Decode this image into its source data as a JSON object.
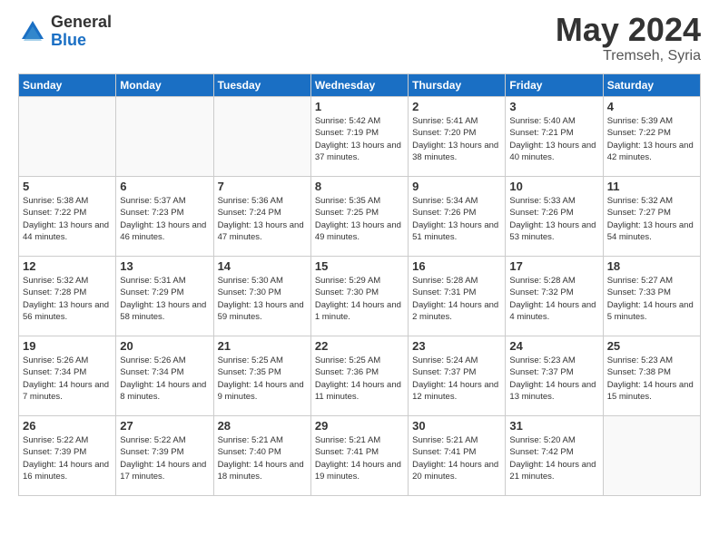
{
  "app": {
    "logo_general": "General",
    "logo_blue": "Blue",
    "month": "May 2024",
    "location": "Tremseh, Syria"
  },
  "calendar": {
    "headers": [
      "Sunday",
      "Monday",
      "Tuesday",
      "Wednesday",
      "Thursday",
      "Friday",
      "Saturday"
    ],
    "weeks": [
      [
        {
          "day": "",
          "info": ""
        },
        {
          "day": "",
          "info": ""
        },
        {
          "day": "",
          "info": ""
        },
        {
          "day": "1",
          "info": "Sunrise: 5:42 AM\nSunset: 7:19 PM\nDaylight: 13 hours\nand 37 minutes."
        },
        {
          "day": "2",
          "info": "Sunrise: 5:41 AM\nSunset: 7:20 PM\nDaylight: 13 hours\nand 38 minutes."
        },
        {
          "day": "3",
          "info": "Sunrise: 5:40 AM\nSunset: 7:21 PM\nDaylight: 13 hours\nand 40 minutes."
        },
        {
          "day": "4",
          "info": "Sunrise: 5:39 AM\nSunset: 7:22 PM\nDaylight: 13 hours\nand 42 minutes."
        }
      ],
      [
        {
          "day": "5",
          "info": "Sunrise: 5:38 AM\nSunset: 7:22 PM\nDaylight: 13 hours\nand 44 minutes."
        },
        {
          "day": "6",
          "info": "Sunrise: 5:37 AM\nSunset: 7:23 PM\nDaylight: 13 hours\nand 46 minutes."
        },
        {
          "day": "7",
          "info": "Sunrise: 5:36 AM\nSunset: 7:24 PM\nDaylight: 13 hours\nand 47 minutes."
        },
        {
          "day": "8",
          "info": "Sunrise: 5:35 AM\nSunset: 7:25 PM\nDaylight: 13 hours\nand 49 minutes."
        },
        {
          "day": "9",
          "info": "Sunrise: 5:34 AM\nSunset: 7:26 PM\nDaylight: 13 hours\nand 51 minutes."
        },
        {
          "day": "10",
          "info": "Sunrise: 5:33 AM\nSunset: 7:26 PM\nDaylight: 13 hours\nand 53 minutes."
        },
        {
          "day": "11",
          "info": "Sunrise: 5:32 AM\nSunset: 7:27 PM\nDaylight: 13 hours\nand 54 minutes."
        }
      ],
      [
        {
          "day": "12",
          "info": "Sunrise: 5:32 AM\nSunset: 7:28 PM\nDaylight: 13 hours\nand 56 minutes."
        },
        {
          "day": "13",
          "info": "Sunrise: 5:31 AM\nSunset: 7:29 PM\nDaylight: 13 hours\nand 58 minutes."
        },
        {
          "day": "14",
          "info": "Sunrise: 5:30 AM\nSunset: 7:30 PM\nDaylight: 13 hours\nand 59 minutes."
        },
        {
          "day": "15",
          "info": "Sunrise: 5:29 AM\nSunset: 7:30 PM\nDaylight: 14 hours\nand 1 minute."
        },
        {
          "day": "16",
          "info": "Sunrise: 5:28 AM\nSunset: 7:31 PM\nDaylight: 14 hours\nand 2 minutes."
        },
        {
          "day": "17",
          "info": "Sunrise: 5:28 AM\nSunset: 7:32 PM\nDaylight: 14 hours\nand 4 minutes."
        },
        {
          "day": "18",
          "info": "Sunrise: 5:27 AM\nSunset: 7:33 PM\nDaylight: 14 hours\nand 5 minutes."
        }
      ],
      [
        {
          "day": "19",
          "info": "Sunrise: 5:26 AM\nSunset: 7:34 PM\nDaylight: 14 hours\nand 7 minutes."
        },
        {
          "day": "20",
          "info": "Sunrise: 5:26 AM\nSunset: 7:34 PM\nDaylight: 14 hours\nand 8 minutes."
        },
        {
          "day": "21",
          "info": "Sunrise: 5:25 AM\nSunset: 7:35 PM\nDaylight: 14 hours\nand 9 minutes."
        },
        {
          "day": "22",
          "info": "Sunrise: 5:25 AM\nSunset: 7:36 PM\nDaylight: 14 hours\nand 11 minutes."
        },
        {
          "day": "23",
          "info": "Sunrise: 5:24 AM\nSunset: 7:37 PM\nDaylight: 14 hours\nand 12 minutes."
        },
        {
          "day": "24",
          "info": "Sunrise: 5:23 AM\nSunset: 7:37 PM\nDaylight: 14 hours\nand 13 minutes."
        },
        {
          "day": "25",
          "info": "Sunrise: 5:23 AM\nSunset: 7:38 PM\nDaylight: 14 hours\nand 15 minutes."
        }
      ],
      [
        {
          "day": "26",
          "info": "Sunrise: 5:22 AM\nSunset: 7:39 PM\nDaylight: 14 hours\nand 16 minutes."
        },
        {
          "day": "27",
          "info": "Sunrise: 5:22 AM\nSunset: 7:39 PM\nDaylight: 14 hours\nand 17 minutes."
        },
        {
          "day": "28",
          "info": "Sunrise: 5:21 AM\nSunset: 7:40 PM\nDaylight: 14 hours\nand 18 minutes."
        },
        {
          "day": "29",
          "info": "Sunrise: 5:21 AM\nSunset: 7:41 PM\nDaylight: 14 hours\nand 19 minutes."
        },
        {
          "day": "30",
          "info": "Sunrise: 5:21 AM\nSunset: 7:41 PM\nDaylight: 14 hours\nand 20 minutes."
        },
        {
          "day": "31",
          "info": "Sunrise: 5:20 AM\nSunset: 7:42 PM\nDaylight: 14 hours\nand 21 minutes."
        },
        {
          "day": "",
          "info": ""
        }
      ]
    ]
  }
}
